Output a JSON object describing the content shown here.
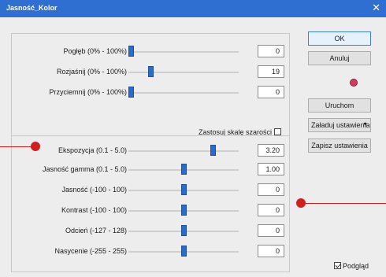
{
  "window": {
    "title": "Jasność_Kolor",
    "close_glyph": "✕"
  },
  "group1": {
    "rows": [
      {
        "label": "Pogłęb (0% - 100%)",
        "value": "0",
        "slider_fraction": 0.0
      },
      {
        "label": "Rozjaśnij (0% - 100%)",
        "value": "19",
        "slider_fraction": 0.19
      },
      {
        "label": "Przyciemnij (0% - 100%)",
        "value": "0",
        "slider_fraction": 0.0
      }
    ],
    "grayscale": {
      "label": "Zastosuj skalę szarości",
      "checked": false
    }
  },
  "group2": {
    "rows": [
      {
        "label": "Ekspozycja (0.1 - 5.0)",
        "value": "3.20",
        "slider_fraction": 0.78
      },
      {
        "label": "Jasność gamma (0.1 - 5.0)",
        "value": "1.00",
        "slider_fraction": 0.5
      },
      {
        "label": "Jasność (-100 - 100)",
        "value": "0",
        "slider_fraction": 0.5
      },
      {
        "label": "Kontrast (-100 - 100)",
        "value": "0",
        "slider_fraction": 0.5
      },
      {
        "label": "Odcień (-127 - 128)",
        "value": "0",
        "slider_fraction": 0.5
      },
      {
        "label": "Nasycenie (-255 - 255)",
        "value": "0",
        "slider_fraction": 0.5
      }
    ]
  },
  "buttons": {
    "ok": "OK",
    "cancel": "Anuluj",
    "run": "Uruchom",
    "load": "Załaduj ustawienia",
    "save": "Zapisz ustawienia"
  },
  "preview": {
    "label": "Podgląd",
    "checked": true
  },
  "colors": {
    "titlebar": "#2f6fd1",
    "slider_thumb": "#2c6cc9",
    "callout": "#d01f1f",
    "gem": "#d43a5e"
  }
}
